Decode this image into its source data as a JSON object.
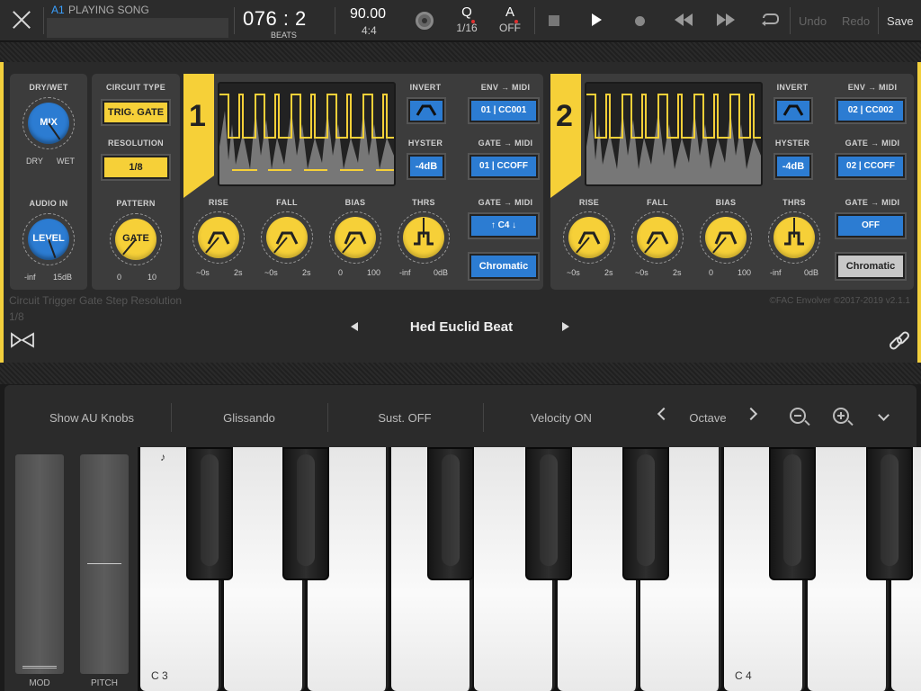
{
  "topbar": {
    "track_id": "A1",
    "track_name": "PLAYING SONG",
    "position": "076 : 2",
    "position_unit": "BEATS",
    "tempo": "90.00",
    "time_signature": "4:4",
    "quantize_label": "Q",
    "quantize_value": "1/16",
    "autoscroll_label": "A",
    "autoscroll_value": "OFF",
    "undo": "Undo",
    "redo": "Redo",
    "save": "Save"
  },
  "plugin": {
    "drywet": {
      "label": "DRY/WET",
      "knob": "MIX",
      "min": "DRY",
      "max": "WET"
    },
    "audio_in": {
      "label": "AUDIO IN",
      "knob": "LEVEL",
      "min": "-inf",
      "max": "15dB"
    },
    "circuit_type": {
      "label": "CIRCUIT TYPE",
      "value": "TRIG. GATE"
    },
    "resolution": {
      "label": "RESOLUTION",
      "value": "1/8"
    },
    "pattern": {
      "label": "PATTERN",
      "knob": "GATE",
      "min": "0",
      "max": "10"
    },
    "envelopes": [
      {
        "number": "1",
        "invert_label": "INVERT",
        "hyster_label": "HYSTER",
        "hyster_value": "-4dB",
        "env_midi_label": "ENV → MIDI",
        "env_midi_value": "01 | CC001",
        "gate_midi_label": "GATE → MIDI",
        "gate_midi_value": "01 | CCOFF",
        "gate_midi2_label": "GATE → MIDI",
        "gate_midi2_value": "↑ C4 ↓",
        "scale_value": "Chromatic",
        "knobs": [
          {
            "label": "RISE",
            "min": "~0s",
            "max": "2s"
          },
          {
            "label": "FALL",
            "min": "~0s",
            "max": "2s"
          },
          {
            "label": "BIAS",
            "min": "0",
            "max": "100"
          },
          {
            "label": "THRS",
            "min": "-inf",
            "max": "0dB"
          }
        ]
      },
      {
        "number": "2",
        "invert_label": "INVERT",
        "hyster_label": "HYSTER",
        "hyster_value": "-4dB",
        "env_midi_label": "ENV → MIDI",
        "env_midi_value": "02 | CC002",
        "gate_midi_label": "GATE → MIDI",
        "gate_midi_value": "02 | CCOFF",
        "gate_midi2_label": "GATE → MIDI",
        "gate_midi2_value": "OFF",
        "scale_value": "Chromatic",
        "knobs": [
          {
            "label": "RISE",
            "min": "~0s",
            "max": "2s"
          },
          {
            "label": "FALL",
            "min": "~0s",
            "max": "2s"
          },
          {
            "label": "BIAS",
            "min": "0",
            "max": "100"
          },
          {
            "label": "THRS",
            "min": "-inf",
            "max": "0dB"
          }
        ]
      }
    ],
    "status_line1": "Circuit Trigger Gate Step Resolution",
    "status_line2": "1/8",
    "copyright": "©FAC Envolver ©2017-2019 v2.1.1",
    "preset_name": "Hed Euclid Beat"
  },
  "keyboard": {
    "options": [
      "Show AU Knobs",
      "Glissando",
      "Sust. OFF",
      "Velocity ON"
    ],
    "octave_label": "Octave",
    "mod_label": "MOD",
    "pitch_label": "PITCH",
    "note_c3": "C 3",
    "note_c4": "C 4",
    "note_icon": "♪"
  },
  "colors": {
    "accent_yellow": "#f6d038",
    "accent_blue": "#2c7cd2",
    "link_blue": "#3aa0ff"
  }
}
